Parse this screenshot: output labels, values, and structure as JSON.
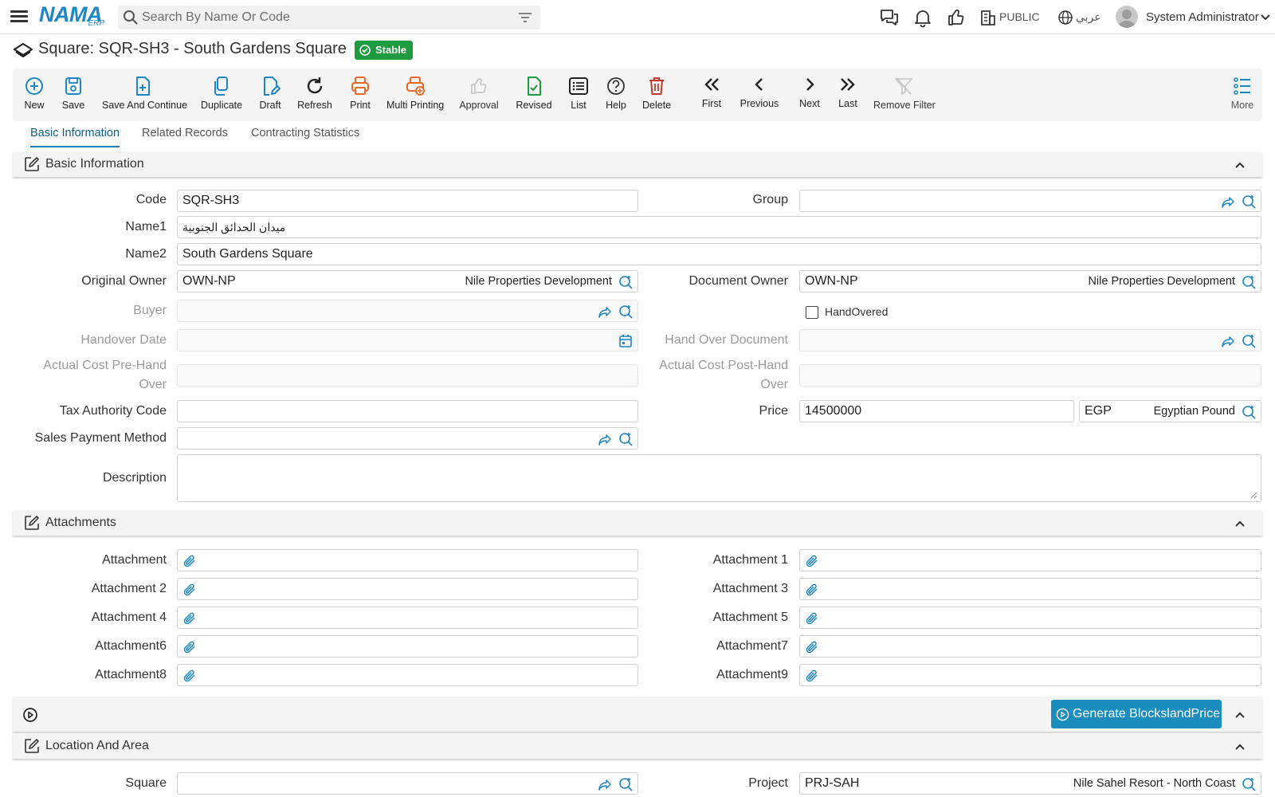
{
  "header": {
    "logo_text": "NAMA",
    "logo_sub": "ERP",
    "search_placeholder": "Search By Name Or Code",
    "company": "PUBLIC",
    "language": "عربي",
    "user_name": "System Administrator"
  },
  "page": {
    "title": "Square: SQR-SH3 - South Gardens Square",
    "status": "Stable",
    "status_color": "#1e9b3e"
  },
  "toolbar": {
    "new": "New",
    "save": "Save",
    "save_continue": "Save And Continue",
    "duplicate": "Duplicate",
    "draft": "Draft",
    "refresh": "Refresh",
    "print": "Print",
    "multi_print": "Multi Printing",
    "approval": "Approval",
    "revised": "Revised",
    "list": "List",
    "help": "Help",
    "delete": "Delete",
    "first": "First",
    "previous": "Previous",
    "next": "Next",
    "last": "Last",
    "remove_filter": "Remove Filter",
    "more": "More"
  },
  "tabs": {
    "basic": "Basic Information",
    "related": "Related Records",
    "stats": "Contracting Statistics"
  },
  "sections": {
    "basic": "Basic Information",
    "attachments": "Attachments",
    "location": "Location And Area"
  },
  "form": {
    "code_label": "Code",
    "code": "SQR-SH3",
    "group_label": "Group",
    "name1_label": "Name1",
    "name1": "ميدان الحدائق الجنوبية",
    "name2_label": "Name2",
    "name2": "South Gardens Square",
    "original_owner_label": "Original Owner",
    "original_owner_code": "OWN-NP",
    "original_owner_name": "Nile Properties Development",
    "document_owner_label": "Document Owner",
    "document_owner_code": "OWN-NP",
    "document_owner_name": "Nile Properties Development",
    "buyer_label": "Buyer",
    "handovered_label": "HandOvered",
    "handover_date_label": "Handover Date",
    "handover_doc_label": "Hand Over Document",
    "cost_pre_label_1": "Actual Cost Pre-Hand",
    "cost_pre_label_2": "Over",
    "cost_post_label_1": "Actual Cost Post-Hand",
    "cost_post_label_2": "Over",
    "tax_label": "Tax Authority Code",
    "price_label": "Price",
    "price": "14500000",
    "currency_code": "EGP",
    "currency_name": "Egyptian Pound",
    "sales_payment_label": "Sales Payment Method",
    "description_label": "Description"
  },
  "attachments": {
    "a0": "Attachment",
    "a1": "Attachment 1",
    "a2": "Attachment 2",
    "a3": "Attachment 3",
    "a4": "Attachment 4",
    "a5": "Attachment 5",
    "a6": "Attachment6",
    "a7": "Attachment7",
    "a8": "Attachment8",
    "a9": "Attachment9"
  },
  "actions": {
    "generate": "Generate BlockslandPrice"
  },
  "location": {
    "square_label": "Square",
    "project_label": "Project",
    "project_code": "PRJ-SAH",
    "project_name": "Nile Sahel Resort - North Coast"
  },
  "colors": {
    "accent": "#1a8dbd",
    "link_icon": "#1f86c4",
    "print": "#e8692a",
    "delete": "#c0392b",
    "revised": "#1e9b3e"
  }
}
